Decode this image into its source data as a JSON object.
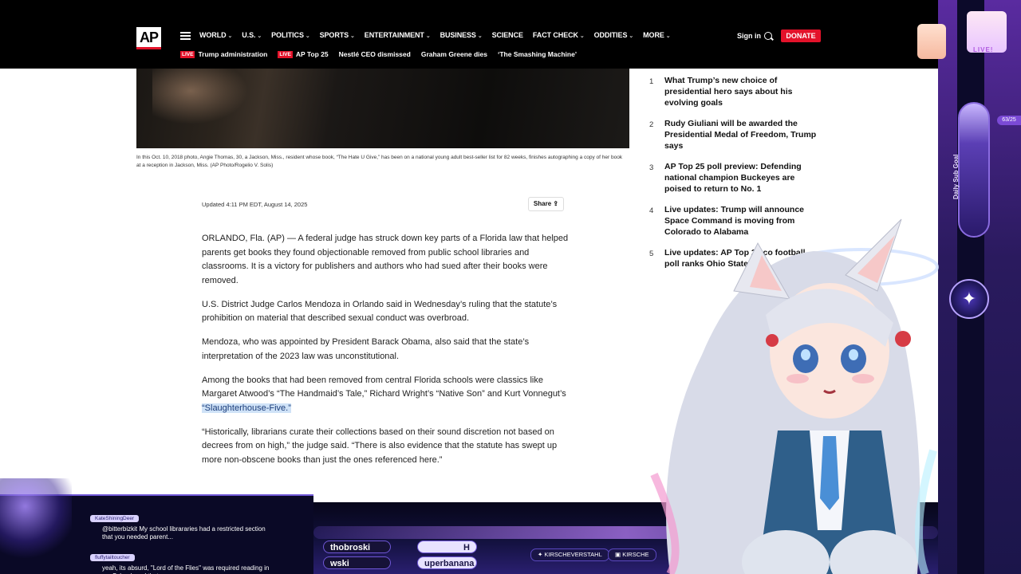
{
  "header": {
    "logo": "AP",
    "nav": [
      "WORLD",
      "U.S.",
      "POLITICS",
      "SPORTS",
      "ENTERTAINMENT",
      "BUSINESS",
      "SCIENCE",
      "FACT CHECK",
      "ODDITIES",
      "MORE"
    ],
    "nav_has_dropdown": [
      true,
      true,
      true,
      true,
      true,
      true,
      false,
      true,
      true,
      true
    ],
    "signin": "Sign in",
    "donate": "DONATE",
    "subnav": [
      {
        "live": "LIVE",
        "label": "Trump administration"
      },
      {
        "live": "LIVE",
        "label": "AP Top 25"
      },
      {
        "live": "",
        "label": "Nestlé CEO dismissed"
      },
      {
        "live": "",
        "label": "Graham Greene dies"
      },
      {
        "live": "",
        "label": "‘The Smashing Machine’"
      }
    ]
  },
  "photo": {
    "caption": "In this Oct. 10, 2018 photo, Angie Thomas, 30, a Jackson, Miss., resident whose book, “The Hate U Give,” has been on a national young adult best-seller list for 82 weeks, finishes autographing a copy of her book at a reception in Jackson, Miss. (AP Photo/Rogelio V. Solis)"
  },
  "article": {
    "updated": "Updated 4:11 PM EDT, August 14, 2025",
    "share": "Share",
    "p1": "ORLANDO, Fla. (AP) — A federal judge has struck down key parts of a Florida law that helped parents get books they found objectionable removed from public school libraries and classrooms. It is a victory for publishers and authors who had sued after their books were removed.",
    "p2": "U.S. District Judge Carlos Mendoza in Orlando said in Wednesday’s ruling that the statute’s prohibition on material that described sexual conduct was overbroad.",
    "p3": "Mendoza, who was appointed by President Barack Obama, also said that the state’s interpretation of the 2023 law was unconstitutional.",
    "p4_before": "Among the books that had been removed from central Florida schools were classics like Margaret Atwood’s “The Handmaid’s Tale,” Richard Wright’s “Native Son” and Kurt Vonnegut’s ",
    "p4_highlight": "“Slaughterhouse-Five.”",
    "p5": "“Historically, librarians curate their collections based on their sound discretion not based on decrees from on high,” the judge said. “There is also evidence that the statute has swept up more non-obscene books than just the ones referenced here.”"
  },
  "trending": [
    {
      "num": "1",
      "title": "What Trump’s new choice of presidential hero says about his evolving goals"
    },
    {
      "num": "2",
      "title": "Rudy Giuliani will be awarded the Presidential Medal of Freedom, Trump says"
    },
    {
      "num": "3",
      "title": "AP Top 25 poll preview: Defending national champion Buckeyes are poised to return to No. 1"
    },
    {
      "num": "4",
      "title": "Live updates: Trump will announce Space Command is moving from Colorado to Alabama"
    },
    {
      "num": "5",
      "title": "Live updates: AP Top 25 co  football poll ranks Ohio State in th"
    }
  ],
  "overlay": {
    "goal_label": "Daily Sub Goal",
    "goal_count": "63/25",
    "live_badge": "LIVE!",
    "pills": [
      "thobroski",
      "H",
      "wski",
      "uperbanana"
    ],
    "socials": [
      "KIRSCHEVERSTAHL",
      "KIRSCHE"
    ],
    "chat": [
      {
        "name": "KateShiningDeer",
        "text": "@bitterbizkit My school librararies had a restricted section that you needed parent..."
      },
      {
        "name": "fluffytailtoucher",
        "text": "yeah, its absurd, \"Lord of the Flies\" was required reading in my School, and that..."
      }
    ]
  },
  "colors": {
    "ap_red": "#e3122a",
    "header_bg": "#000000",
    "highlight": "#cfe2f7",
    "overlay_purple": "#6f57d6"
  }
}
